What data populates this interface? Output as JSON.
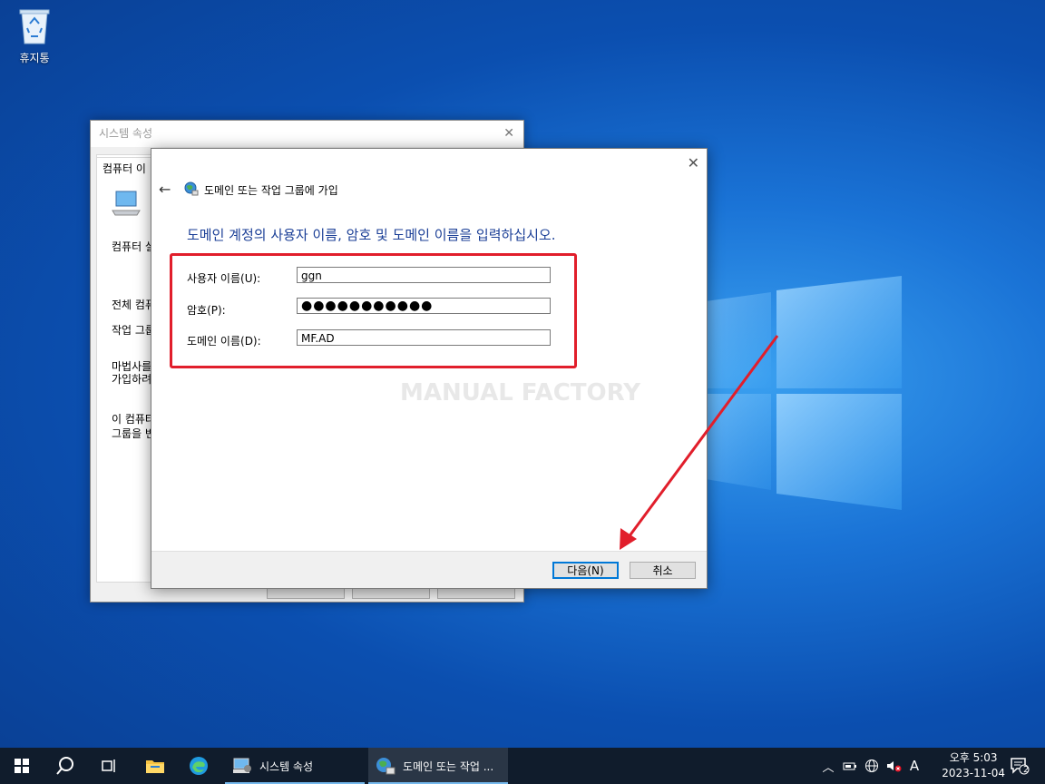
{
  "desktop": {
    "recycle_bin_label": "휴지통"
  },
  "system_properties": {
    "title": "시스템 속성",
    "tab_fragment": "컴퓨터 이",
    "frag_1": "컴퓨터 설",
    "frag_2": "전체 컴퓨",
    "frag_3": "작업 그룹",
    "frag_4a": "마법사를",
    "frag_4b": "가입하려",
    "frag_5a": "이 컴퓨터",
    "frag_5b": "그룹을 변"
  },
  "wizard": {
    "title": "도메인 또는 작업 그룹에 가입",
    "heading": "도메인 계정의 사용자 이름, 암호 및 도메인 이름을 입력하십시오.",
    "username_label": "사용자 이름(U):",
    "username_value": "ggn",
    "password_label": "암호(P):",
    "password_value": "●●●●●●●●●●●",
    "domain_label": "도메인 이름(D):",
    "domain_value": "MF.AD",
    "watermark": "MANUAL FACTORY",
    "next_button": "다음(N)",
    "cancel_button": "취소"
  },
  "taskbar": {
    "app1_label": "시스템 속성",
    "app2_label": "도메인 또는 작업 ...",
    "ime_indicator": "A",
    "time": "오후 5:03",
    "date": "2023-11-04",
    "notification_count": "2"
  },
  "colors": {
    "accent": "#0078d7",
    "heading_blue": "#1a3e96",
    "annotation_red": "#e11e2b",
    "taskbar_bg": "#101c2c"
  }
}
